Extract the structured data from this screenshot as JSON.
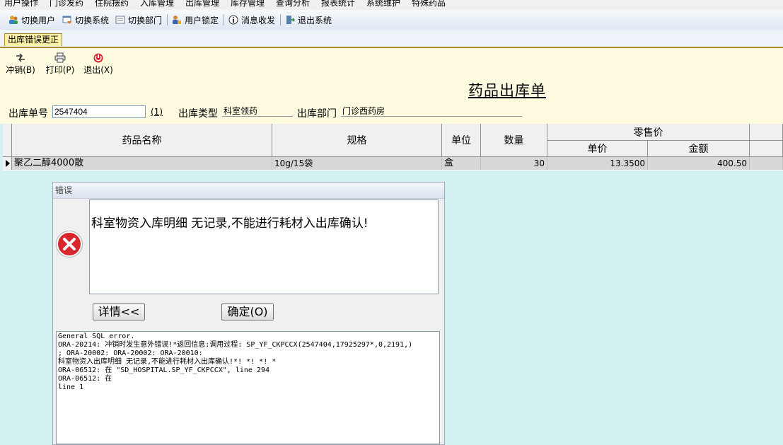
{
  "menu": [
    "用户操作",
    "门诊发药",
    "住院摆药",
    "入库管理",
    "出库管理",
    "库存管理",
    "查询分析",
    "报表统计",
    "系统维护",
    "特殊药品"
  ],
  "toolbar": {
    "switch_user": "切换用户",
    "switch_system": "切换系统",
    "switch_dept": "切换部门",
    "lock_user": "用户锁定",
    "messages": "消息收发",
    "exit_system": "退出系统"
  },
  "tab": {
    "label": "出库错误更正"
  },
  "actions": {
    "reverse": "冲销(B)",
    "print": "打印(P)",
    "exit": "退出(X)"
  },
  "form": {
    "title": "药品出库单",
    "order_no_label": "出库单号",
    "order_no_value": "2547404",
    "order_no_hint": "(1)",
    "type_label": "出库类型",
    "type_value": "科室领药",
    "dept_label": "出库部门",
    "dept_value": "门诊西药房"
  },
  "grid": {
    "headers": {
      "name": "药品名称",
      "spec": "规格",
      "unit": "单位",
      "qty": "数量",
      "retail": "零售价",
      "price": "单价",
      "amount": "金额"
    },
    "rows": [
      {
        "name": "聚乙二醇4000散",
        "spec": "10g/15袋",
        "unit": "盒",
        "qty": "30",
        "price": "13.3500",
        "amount": "400.50"
      }
    ]
  },
  "dialog": {
    "title": "错误",
    "message": "科室物资入库明细 无记录,不能进行耗材入出库确认!",
    "details_button": "详情<<",
    "ok_button": "确定(O)",
    "detail_text": "General SQL error.\nORA-20214: 冲销时发生意外错误!*返回信息:调用过程: SP_YF_CKPCCX(2547404,17925297*,0,2191,)\n; ORA-20002: ORA-20002: ORA-20010:\n科室物资入出库明细 无记录,不能进行耗材入出库确认!*! *! *! *\nORA-06512: 在 \"SD_HOSPITAL.SP_YF_CKPCCX\", line 294\nORA-06512: 在\nline 1"
  },
  "colors": {
    "form_bg": "#fffbe0",
    "body_bg": "#d3f1f0",
    "tab_bg": "#fff1a8",
    "error_red": "#d9262c"
  }
}
